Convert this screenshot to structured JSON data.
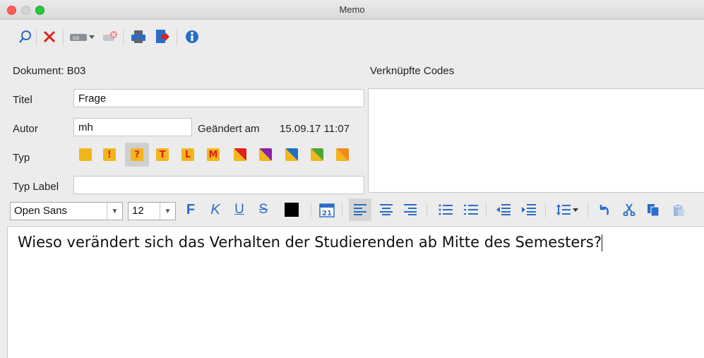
{
  "window": {
    "title": "Memo"
  },
  "header": {
    "dokument_label": "Dokument: B03",
    "linked_codes_label": "Verknüpfte Codes"
  },
  "form": {
    "titel_label": "Titel",
    "titel_value": "Frage",
    "autor_label": "Autor",
    "autor_value": "mh",
    "changed_label": "Geändert am",
    "changed_value": "15.09.17 11:07",
    "typ_label": "Typ",
    "typ_label_label": "Typ Label",
    "typ_label_value": ""
  },
  "typ_icons": [
    {
      "name": "memo-plain-icon",
      "symbol": ""
    },
    {
      "name": "memo-exclamation-icon",
      "symbol": "!"
    },
    {
      "name": "memo-question-icon",
      "symbol": "?"
    },
    {
      "name": "memo-t-icon",
      "symbol": "T"
    },
    {
      "name": "memo-l-icon",
      "symbol": "L"
    },
    {
      "name": "memo-m-icon",
      "symbol": "M"
    }
  ],
  "format": {
    "font": "Open Sans",
    "size": "12",
    "bold": "F",
    "italic": "K",
    "underline": "U",
    "strike": "S",
    "date_icon_text": "21"
  },
  "editor": {
    "text": "Wieso verändert sich das Verhalten der Studierenden ab Mitte des Semesters?"
  },
  "colors": {
    "accent": "#2b6cc8",
    "memo_yellow": "#f2b51c",
    "memo_red": "#e0201c"
  }
}
